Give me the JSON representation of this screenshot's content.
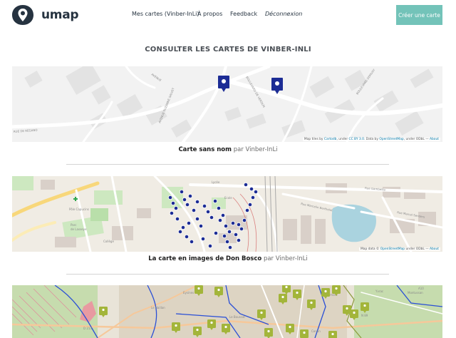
{
  "header": {
    "brand": "umap",
    "nav": {
      "my_maps": "Mes cartes (Vinber-InLi)",
      "about": "À propos",
      "feedback": "Feedback",
      "logout": "Déconnexion"
    },
    "create_button": "Créer une carte"
  },
  "page_title": "CONSULTER LES CARTES DE VINBER-INLI",
  "maps": [
    {
      "title": "Carte sans nom",
      "by": "par",
      "author": "Vinber-InLi",
      "attribution": {
        "prefix": "Map tiles by",
        "provider": "Cartodb",
        "under": ", under",
        "license": "CC BY 3.0",
        "data": ". Data by",
        "osm": "OpenStreetMap",
        "suffix": ", under ODbL —",
        "about": "About"
      },
      "streets": [
        "AVENUE SUZANNE SALVET",
        "BOULEVARD DE VERDUN",
        "AVENUE DE VERDUN",
        "BOULEVARD DEMUSY",
        "RUE DE REGANO"
      ]
    },
    {
      "title": "La carte en images de Don Bosco",
      "by": "par",
      "author": "Vinber-InLi",
      "attribution": {
        "prefix": "Map data ©",
        "osm": "OpenStreetMap",
        "suffix": "under ODbL —",
        "about": "About"
      },
      "places": [
        "Lycée",
        "Ecole",
        "Pôle Capucins",
        "Parc de Lasseye",
        "Collège",
        "Rue Marcelin Berthelot",
        "Rue Marcel Senders",
        "Rue Gambetta"
      ]
    },
    {
      "places": [
        "Eysines",
        "Le Haillan",
        "Le Bouscat",
        "Lormont",
        "Cenon",
        "Montussan",
        "Yvrac"
      ],
      "roads": [
        "D 213",
        "N 89",
        "A10"
      ]
    }
  ],
  "colors": {
    "accent": "#73c3b9",
    "marker": "#1c2c95",
    "brand": "#263340"
  }
}
